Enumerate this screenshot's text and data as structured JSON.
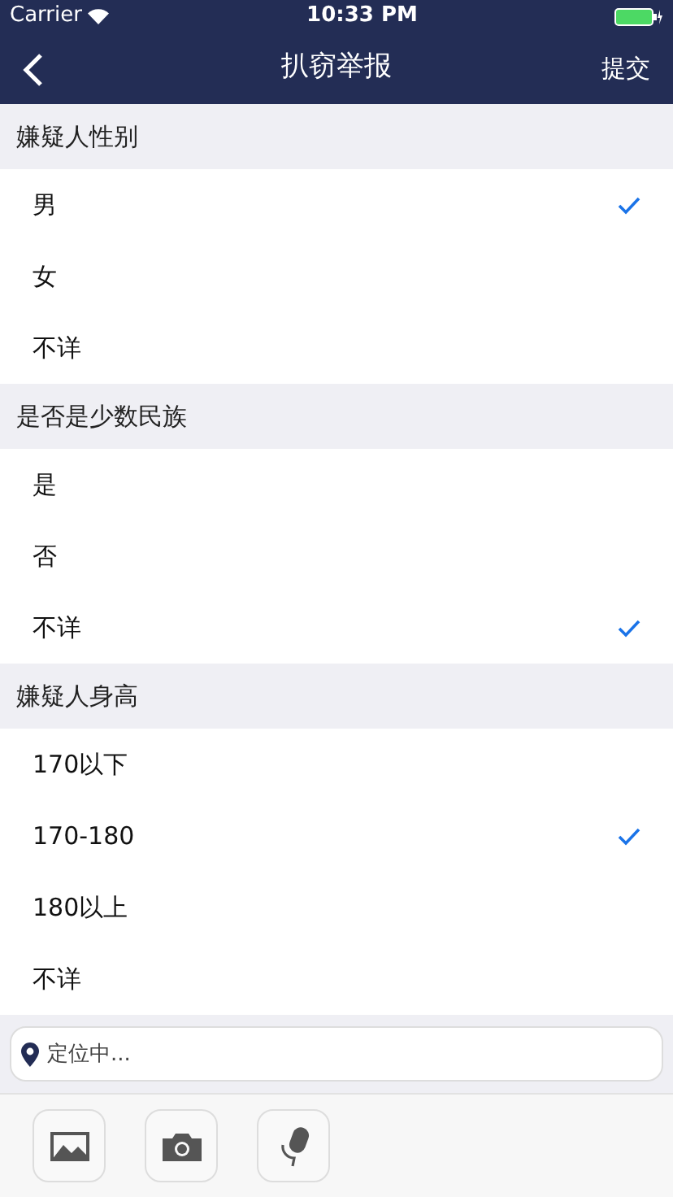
{
  "status_bar": {
    "carrier": "Carrier",
    "time": "10:33 PM"
  },
  "nav": {
    "title": "扒窃举报",
    "action": "提交"
  },
  "sections": [
    {
      "title": "嫌疑人性别",
      "options": [
        {
          "label": "男",
          "selected": true
        },
        {
          "label": "女",
          "selected": false
        },
        {
          "label": "不详",
          "selected": false
        }
      ]
    },
    {
      "title": "是否是少数民族",
      "options": [
        {
          "label": "是",
          "selected": false
        },
        {
          "label": "否",
          "selected": false
        },
        {
          "label": "不详",
          "selected": true
        }
      ]
    },
    {
      "title": "嫌疑人身高",
      "options": [
        {
          "label": "170以下",
          "selected": false
        },
        {
          "label": "170-180",
          "selected": true
        },
        {
          "label": "180以上",
          "selected": false
        },
        {
          "label": "不详",
          "selected": false
        }
      ]
    }
  ],
  "location": {
    "placeholder": "定位中..."
  },
  "toolbar": [
    {
      "kind": "image"
    },
    {
      "kind": "camera"
    },
    {
      "kind": "microphone"
    }
  ]
}
